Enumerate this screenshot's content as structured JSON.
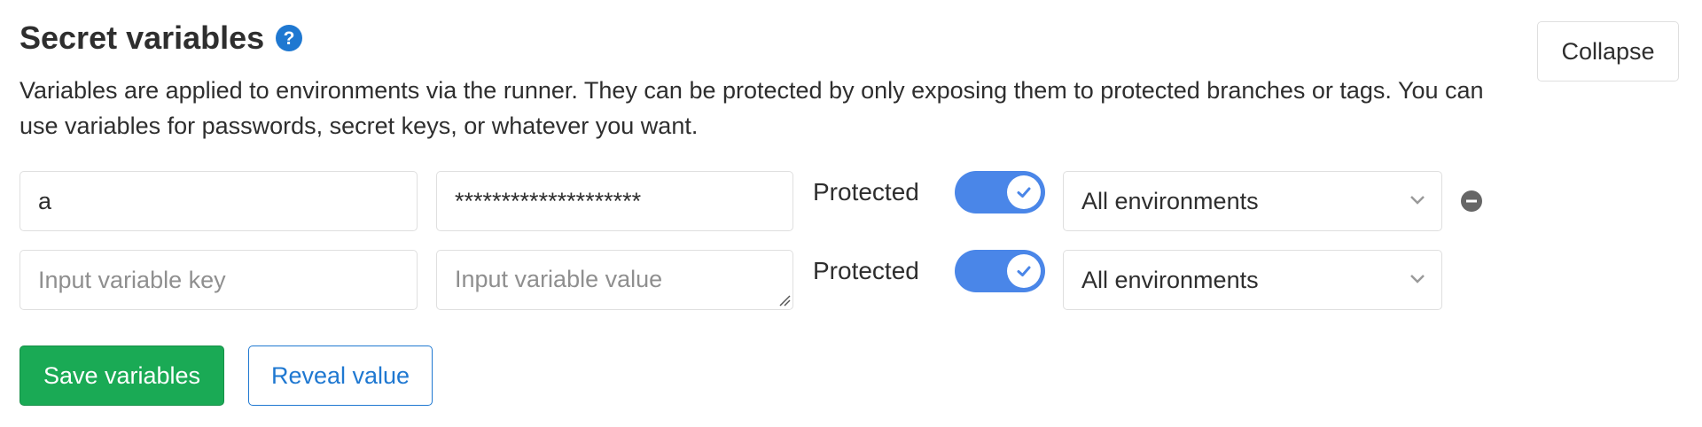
{
  "header": {
    "title": "Secret variables",
    "help_icon": "question-circle-icon",
    "collapse_label": "Collapse"
  },
  "description": "Variables are applied to environments via the runner. They can be protected by only exposing them to protected branches or tags. You can use variables for passwords, secret keys, or whatever you want.",
  "variables": [
    {
      "key": "a",
      "key_placeholder": "Input variable key",
      "value": "********************",
      "value_placeholder": "Input variable value",
      "protected_label": "Protected",
      "protected": true,
      "environment": "All environments",
      "remove_icon": "minus-circle-icon"
    },
    {
      "key": "",
      "key_placeholder": "Input variable key",
      "value": "",
      "value_placeholder": "Input variable value",
      "protected_label": "Protected",
      "protected": true,
      "environment": "All environments"
    }
  ],
  "actions": {
    "save_label": "Save variables",
    "reveal_label": "Reveal value"
  },
  "colors": {
    "toggle_on": "#4a86e8",
    "save_button": "#1aaa55",
    "reveal_button": "#1f78d1",
    "help_icon": "#1f78d1"
  }
}
